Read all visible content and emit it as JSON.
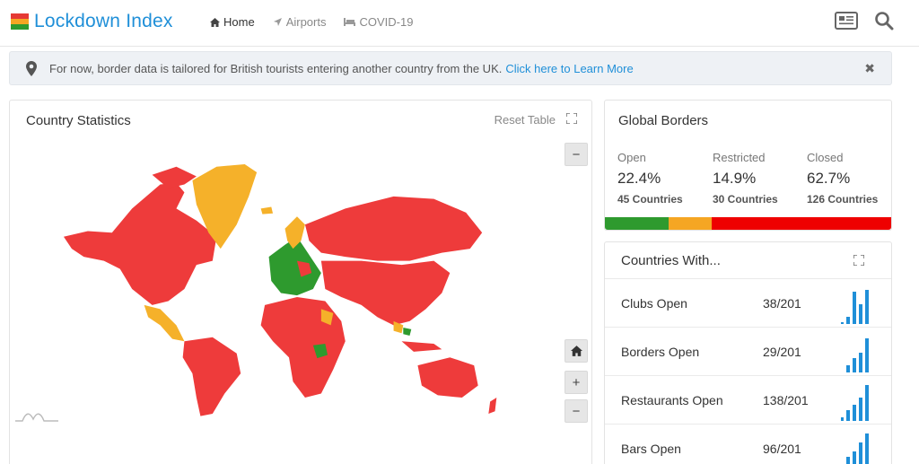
{
  "app": {
    "title": "Lockdown Index"
  },
  "nav": [
    {
      "label": "Home",
      "icon": "home-icon",
      "active": true
    },
    {
      "label": "Airports",
      "icon": "plane-icon",
      "active": false
    },
    {
      "label": "COVID-19",
      "icon": "bed-icon",
      "active": false
    }
  ],
  "notice": {
    "text": "For now, border data is tailored for British tourists entering another country from the UK.",
    "link": "Click here to Learn More"
  },
  "map_panel": {
    "title": "Country Statistics",
    "reset": "Reset Table",
    "zoom_in": "+",
    "zoom_out": "−"
  },
  "global_borders": {
    "title": "Global Borders",
    "stats": [
      {
        "label": "Open",
        "percent": "22.4%",
        "count": "45 Countries",
        "color": "#2e9a2e"
      },
      {
        "label": "Restricted",
        "percent": "14.9%",
        "count": "30 Countries",
        "color": "#f5a623"
      },
      {
        "label": "Closed",
        "percent": "62.7%",
        "count": "126 Countries",
        "color": "#ee0000"
      }
    ],
    "bar_fractions": [
      0.224,
      0.149,
      0.627
    ]
  },
  "countries_with": {
    "title": "Countries With...",
    "rows": [
      {
        "label": "Clubs Open",
        "value": "38/201"
      },
      {
        "label": "Borders Open",
        "value": "29/201"
      },
      {
        "label": "Restaurants Open",
        "value": "138/201"
      },
      {
        "label": "Bars Open",
        "value": "96/201"
      }
    ]
  },
  "colors": {
    "open": "#2e9a2e",
    "restricted": "#f5a623",
    "closed": "#ee0000",
    "accent": "#1f8fd8",
    "spark": "#1f8fd8"
  }
}
